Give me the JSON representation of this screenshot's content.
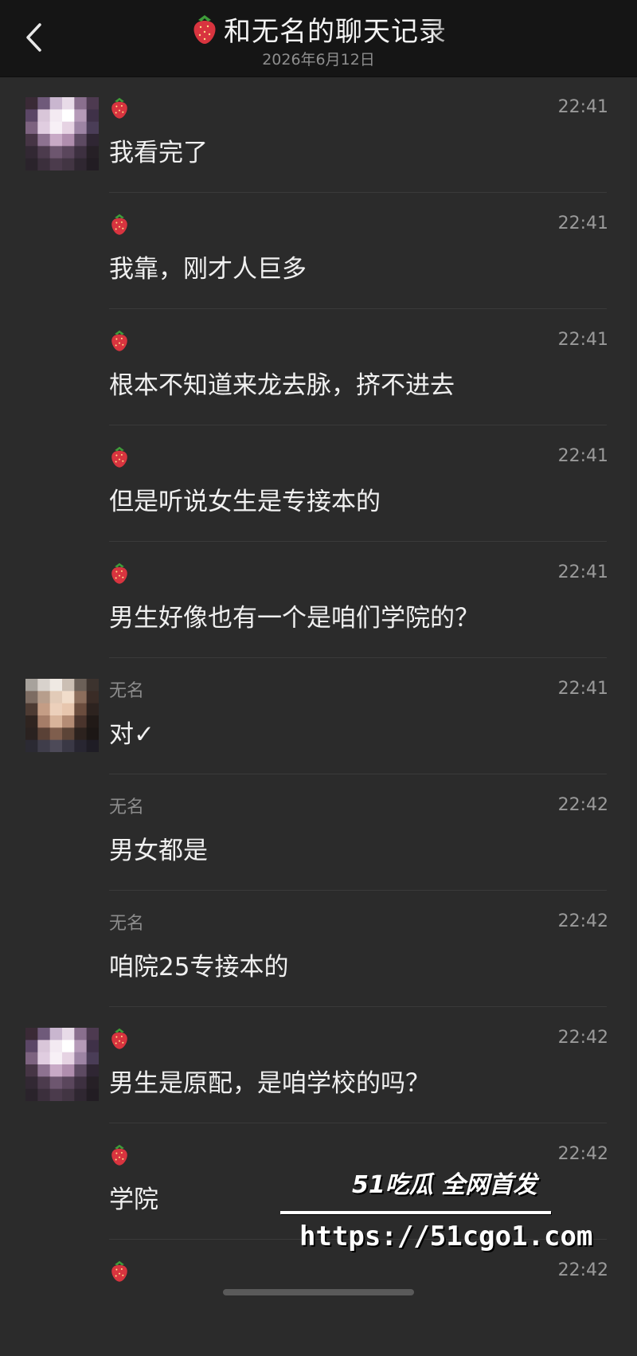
{
  "header": {
    "title": "和无名的聊天记录",
    "date": "2026年6月12日"
  },
  "messages": [
    {
      "sender": "",
      "sender_icon": "strawberry-icon",
      "time": "22:41",
      "text": "我看完了",
      "avatar": true,
      "avatar_tone": "pink"
    },
    {
      "sender": "",
      "sender_icon": "strawberry-icon",
      "time": "22:41",
      "text": "我靠，刚才人巨多",
      "avatar": false
    },
    {
      "sender": "",
      "sender_icon": "strawberry-icon",
      "time": "22:41",
      "text": "根本不知道来龙去脉，挤不进去",
      "avatar": false
    },
    {
      "sender": "",
      "sender_icon": "strawberry-icon",
      "time": "22:41",
      "text": "但是听说女生是专接本的",
      "avatar": false
    },
    {
      "sender": "",
      "sender_icon": "strawberry-icon",
      "time": "22:41",
      "text": "男生好像也有一个是咱们学院的？",
      "avatar": false
    },
    {
      "sender": "无名",
      "time": "22:41",
      "text": "对✓",
      "avatar": true,
      "avatar_tone": "dark"
    },
    {
      "sender": "无名",
      "time": "22:42",
      "text": "男女都是",
      "avatar": false
    },
    {
      "sender": "无名",
      "time": "22:42",
      "text": "咱院25专接本的",
      "avatar": false
    },
    {
      "sender": "",
      "sender_icon": "strawberry-icon",
      "time": "22:42",
      "text": "男生是原配，是咱学校的吗？",
      "avatar": true,
      "avatar_tone": "pink"
    },
    {
      "sender": "",
      "sender_icon": "strawberry-icon",
      "time": "22:42",
      "text": "学院",
      "avatar": false
    },
    {
      "sender": "",
      "sender_icon": "strawberry-icon",
      "time": "22:42",
      "text": "",
      "avatar": false
    }
  ],
  "watermark": {
    "line1": "51吃瓜 全网首发",
    "url": "https://51cgo1.com"
  },
  "colors": {
    "background": "#2b2b2b",
    "header": "#151515",
    "strawberry": "#d8343f"
  }
}
